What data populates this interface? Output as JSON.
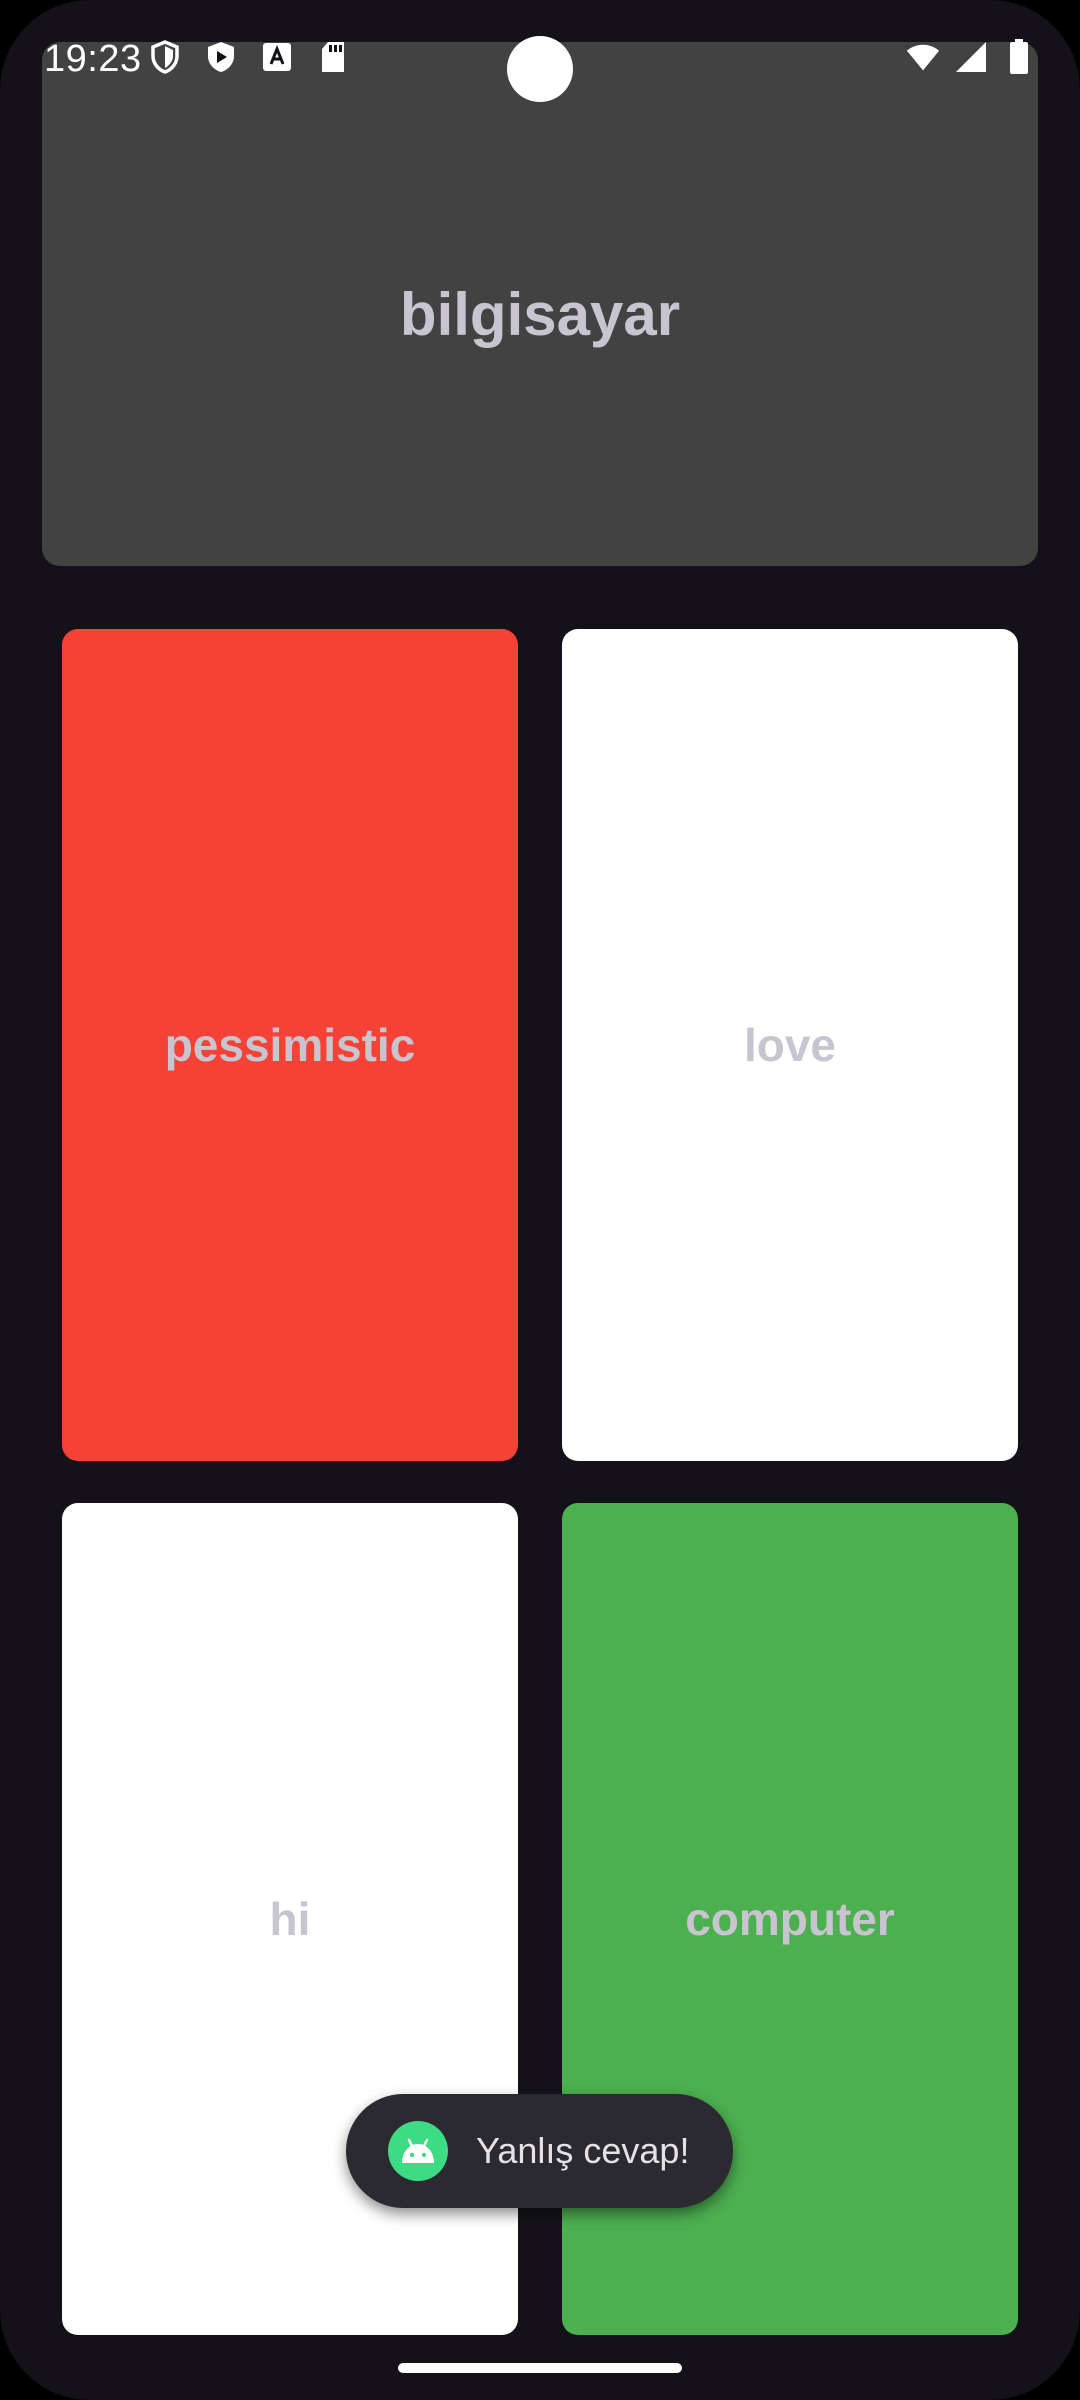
{
  "status_bar": {
    "time": "19:23",
    "left_icons": [
      "shield-icon",
      "play-protect-icon",
      "a-badge-icon",
      "sd-card-icon"
    ],
    "right_icons": [
      "wifi-icon",
      "signal-icon",
      "battery-icon"
    ]
  },
  "question": {
    "word": "bilgisayar",
    "background": "#424242"
  },
  "answers": [
    {
      "label": "pessimistic",
      "background": "#f44336",
      "state": "wrong"
    },
    {
      "label": "love",
      "background": "#ffffff",
      "state": "neutral"
    },
    {
      "label": "hi",
      "background": "#ffffff",
      "state": "neutral"
    },
    {
      "label": "computer",
      "background": "#4caf50",
      "state": "correct"
    }
  ],
  "toast": {
    "message": "Yanlış cevap!",
    "icon": "android-icon"
  },
  "colors": {
    "app_background": "#141218",
    "answer_text": "#c9c5d0",
    "wrong": "#f44336",
    "correct": "#4caf50"
  }
}
